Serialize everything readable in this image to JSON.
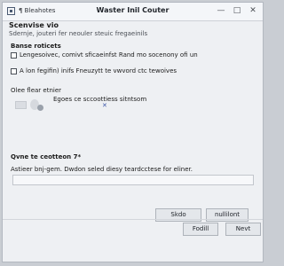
{
  "titlebar": {
    "left_text": "¶ Bleahotes",
    "title": "Waster Inil Couter",
    "buttons": [
      "—",
      "□",
      "✕"
    ]
  },
  "header": {
    "heading": "Scenvise vio",
    "subtext": "Sdernje, jouteri fer neouler steuic fregaeinils"
  },
  "section1": {
    "heading": "Banse roticets",
    "row1": "Lengesoivec, comivt sficaeinfst Rand mo socenony ofi un",
    "row2": "A lon fegifin) inifs Fneuzytt te vwvord ctc tewoives"
  },
  "section2": {
    "heading": "Olee flear etnier",
    "subtext": "Egoes ce sccoottiess sitntsom"
  },
  "section3": {
    "heading": "Qvne te ceotteon 7*",
    "description": "Astieer bnj-gem. Dwdon seled diesy teardcctese for eliner.",
    "input_value": ""
  },
  "mid_buttons": {
    "left": "Skdo",
    "right": "nullilont"
  },
  "footer_buttons": {
    "left": "Fodill",
    "right": "Nevt"
  }
}
